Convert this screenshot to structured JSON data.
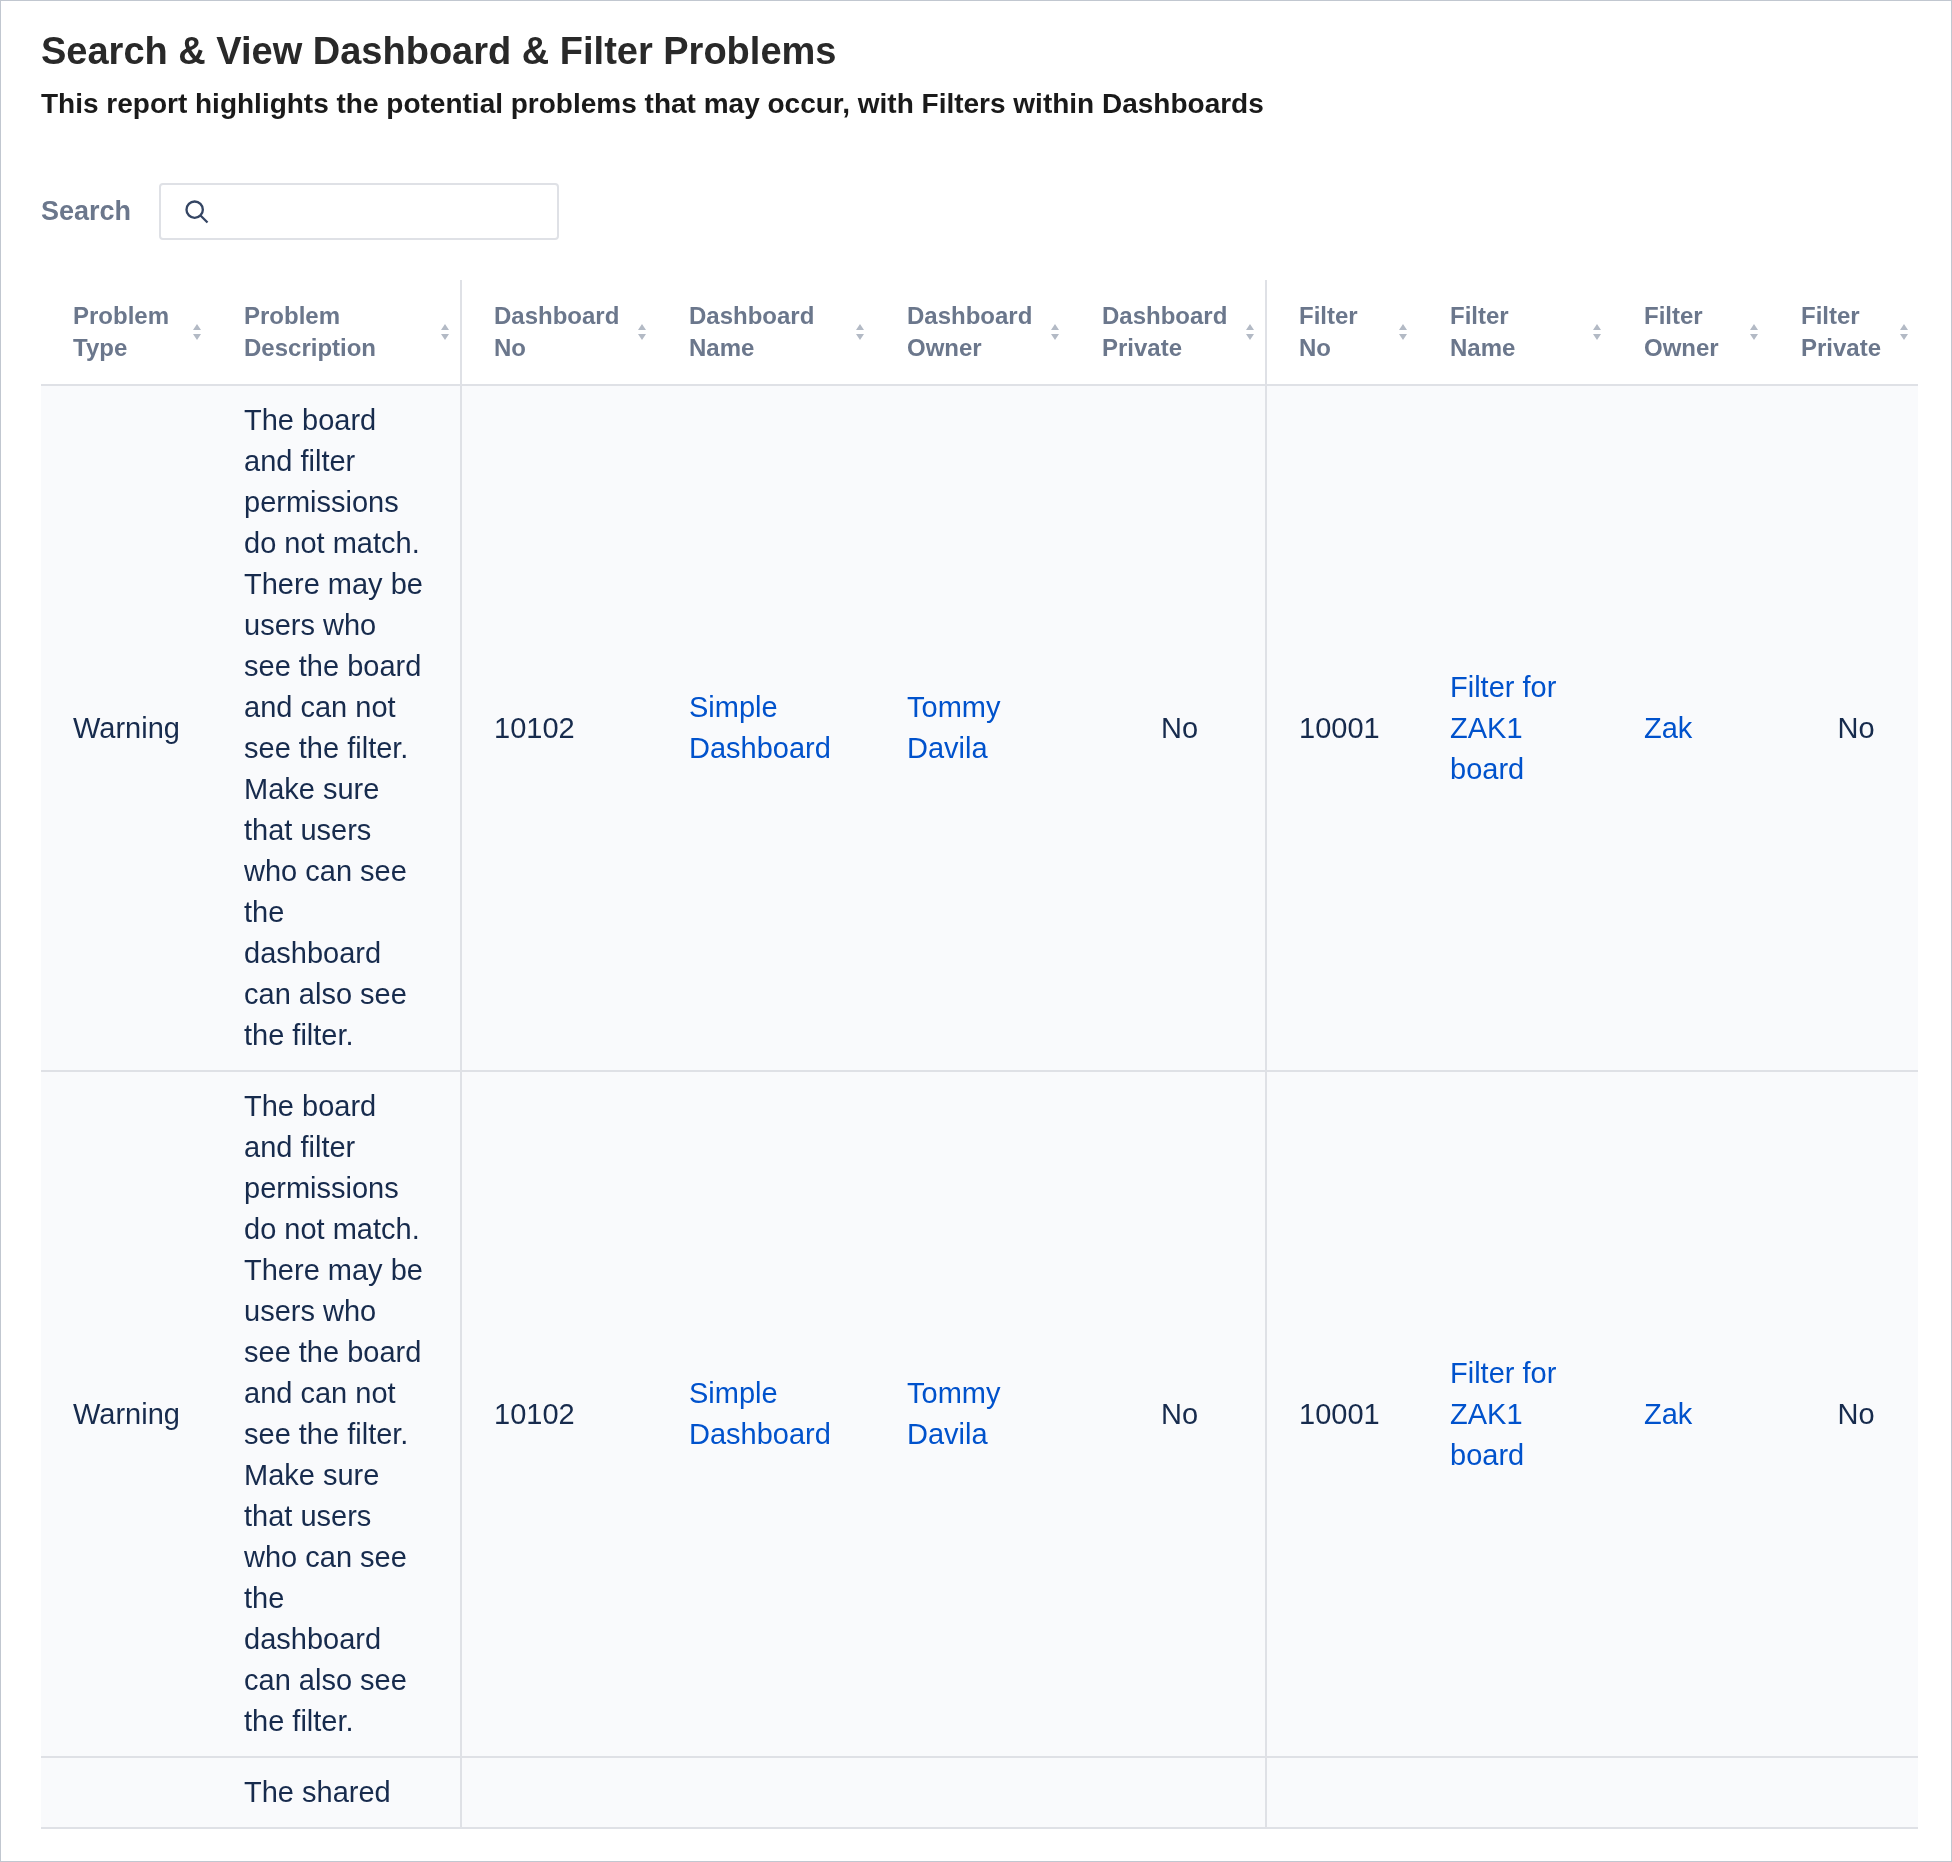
{
  "title": "Search & View Dashboard & Filter Problems",
  "subtitle": "This report highlights the potential problems that may occur, with Filters within Dashboards",
  "search": {
    "label": "Search"
  },
  "table": {
    "columns": [
      "Problem Type",
      "Problem Description",
      "Dashboard No",
      "Dashboard Name",
      "Dashboard Owner",
      "Dashboard Private",
      "Filter No",
      "Filter Name",
      "Filter Owner",
      "Filter Private"
    ],
    "rows": [
      {
        "cells": [
          {
            "kind": "text",
            "text": "Warning"
          },
          {
            "kind": "text",
            "text": "The board and filter permissions do not match. There may be users who see the board and can not see the filter. Make sure that users who can see the dashboard can also see the filter."
          },
          {
            "kind": "text",
            "text": "10102"
          },
          {
            "kind": "link",
            "text": "Simple Dashboard"
          },
          {
            "kind": "link",
            "text": "Tommy Davila"
          },
          {
            "kind": "text",
            "text": "No"
          },
          {
            "kind": "text",
            "text": "10001"
          },
          {
            "kind": "link",
            "text": "Filter for ZAK1 board"
          },
          {
            "kind": "link",
            "text": "Zak"
          },
          {
            "kind": "text",
            "text": "No"
          }
        ]
      },
      {
        "cells": [
          {
            "kind": "text",
            "text": "Warning"
          },
          {
            "kind": "text",
            "text": "The board and filter permissions do not match. There may be users who see the board and can not see the filter. Make sure that users who can see the dashboard can also see the filter."
          },
          {
            "kind": "text",
            "text": "10102"
          },
          {
            "kind": "link",
            "text": "Simple Dashboard"
          },
          {
            "kind": "link",
            "text": "Tommy Davila"
          },
          {
            "kind": "text",
            "text": "No"
          },
          {
            "kind": "text",
            "text": "10001"
          },
          {
            "kind": "link",
            "text": "Filter for ZAK1 board"
          },
          {
            "kind": "link",
            "text": "Zak"
          },
          {
            "kind": "text",
            "text": "No"
          }
        ]
      },
      {
        "cells": [
          {
            "kind": "empty"
          },
          {
            "kind": "text",
            "text": "The shared"
          }
        ]
      }
    ]
  }
}
